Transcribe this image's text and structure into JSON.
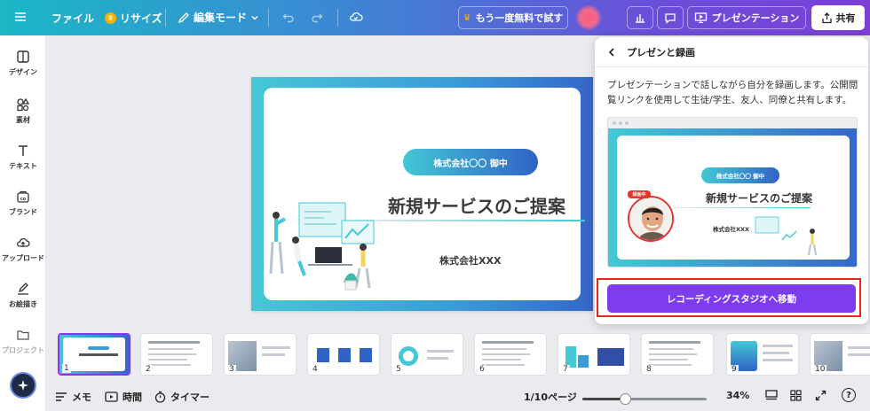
{
  "topbar": {
    "file_label": "ファイル",
    "resize_label": "リサイズ",
    "edit_mode_label": "編集モード",
    "try_free_label": "もう一度無料で試す",
    "present_label": "プレゼンテーション",
    "share_label": "共有"
  },
  "rail": {
    "items": [
      {
        "label": "デザイン"
      },
      {
        "label": "素材"
      },
      {
        "label": "テキスト"
      },
      {
        "label": "ブランド"
      },
      {
        "label": "アップロード"
      },
      {
        "label": "お絵描き"
      },
      {
        "label": "プロジェクト"
      }
    ]
  },
  "slide": {
    "pill": "株式会社〇〇 御中",
    "title": "新規サービスのご提案",
    "company": "株式会社XXX"
  },
  "panel": {
    "title": "プレゼンと録画",
    "description": "プレゼンテーションで話しながら自分を録画します。公開閲覧リンクを使用して生徒/学生、友人、同僚と共有します。",
    "preview_pill": "株式会社〇〇 御中",
    "preview_title": "新規サービスのご提案",
    "preview_company": "株式会社XXX",
    "rec_badge": "録画中",
    "studio_button": "レコーディングスタジオへ移動"
  },
  "thumbnails": [
    {
      "num": "1"
    },
    {
      "num": "2"
    },
    {
      "num": "3"
    },
    {
      "num": "4"
    },
    {
      "num": "5"
    },
    {
      "num": "6"
    },
    {
      "num": "7"
    },
    {
      "num": "8"
    },
    {
      "num": "9"
    },
    {
      "num": "10"
    }
  ],
  "bottombar": {
    "notes_label": "メモ",
    "timer_time_label": "時間",
    "timer_label": "タイマー",
    "page_indicator": "1/10ページ",
    "zoom_value": "34%",
    "zoom_fraction": 0.34,
    "help": "?"
  },
  "colors": {
    "accent": "#7d3cf0",
    "highlight_outline": "#e8241c",
    "slide_gradient_start": "#44c8d6",
    "slide_gradient_end": "#3566c9"
  }
}
